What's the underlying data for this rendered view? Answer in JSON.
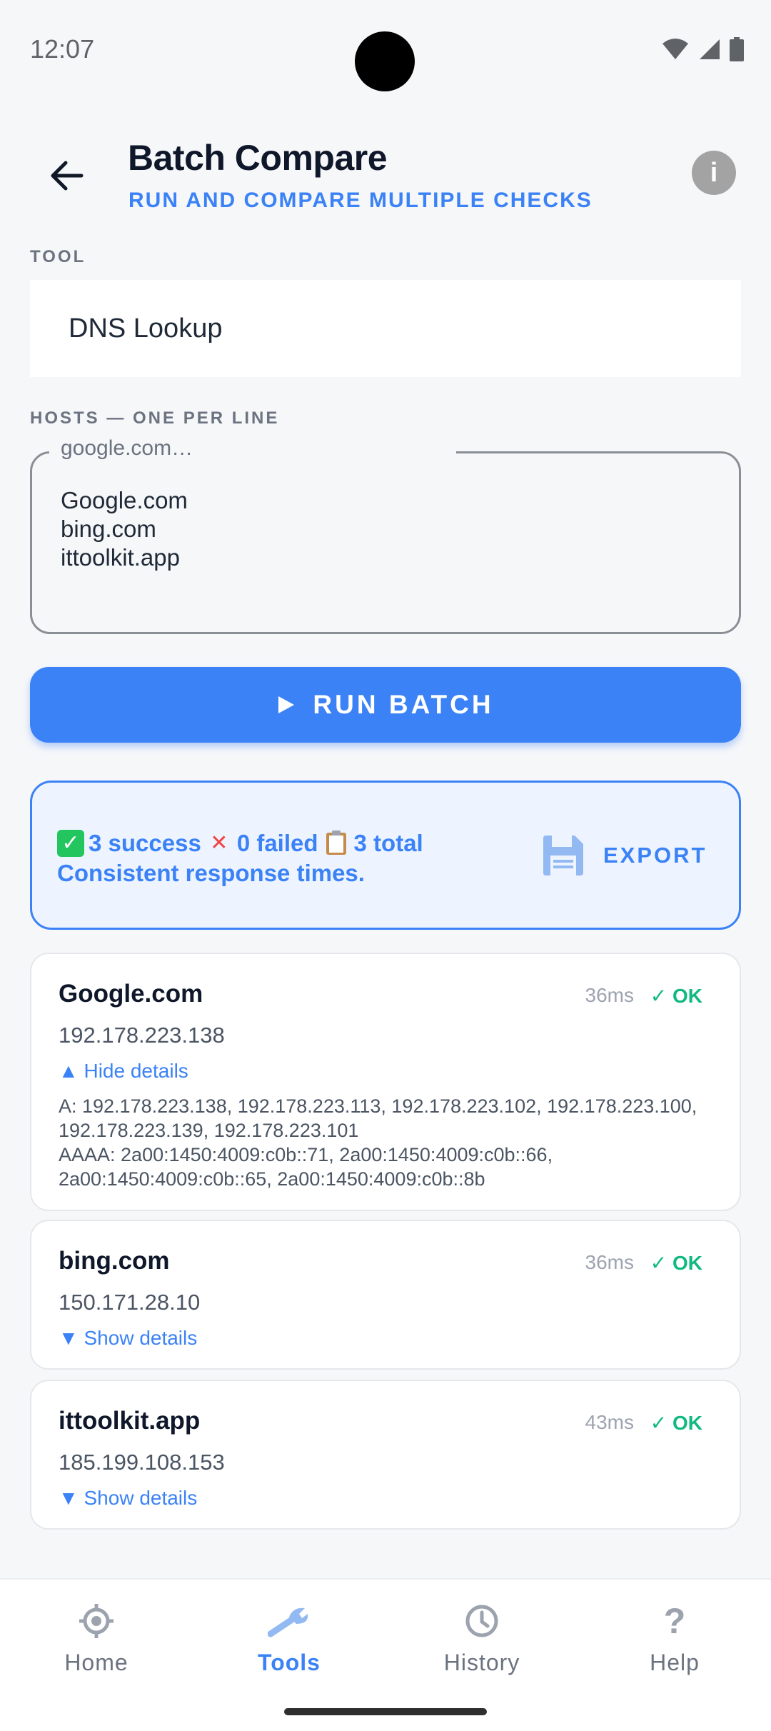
{
  "status_bar": {
    "time": "12:07"
  },
  "header": {
    "title": "Batch Compare",
    "subtitle": "RUN AND COMPARE MULTIPLE CHECKS",
    "back_icon": "arrow-left-icon",
    "info_icon": "info-icon"
  },
  "tool": {
    "label": "TOOL",
    "value": "DNS Lookup"
  },
  "hosts": {
    "label": "HOSTS — ONE PER LINE",
    "placeholder": "google.com…",
    "value": "Google.com\nbing.com\nittoolkit.app"
  },
  "run_button": {
    "label": "RUN BATCH",
    "icon": "play-icon"
  },
  "summary": {
    "success": "3 success",
    "failed": "0 failed",
    "total": "3 total",
    "note": "Consistent response times.",
    "export_label": "EXPORT",
    "export_icon": "save-icon"
  },
  "results": [
    {
      "host": "Google.com",
      "time": "36ms",
      "status": "✓ OK",
      "ip": "192.178.223.138",
      "toggle": "▲ Hide details",
      "details": "A: 192.178.223.138, 192.178.223.113, 192.178.223.102, 192.178.223.100, 192.178.223.139, 192.178.223.101\nAAAA: 2a00:1450:4009:c0b::71, 2a00:1450:4009:c0b::66, 2a00:1450:4009:c0b::65, 2a00:1450:4009:c0b::8b"
    },
    {
      "host": "bing.com",
      "time": "36ms",
      "status": "✓ OK",
      "ip": "150.171.28.10",
      "toggle": "▼ Show details"
    },
    {
      "host": "ittoolkit.app",
      "time": "43ms",
      "status": "✓ OK",
      "ip": "185.199.108.153",
      "toggle": "▼ Show details"
    }
  ],
  "bottom_nav": [
    {
      "label": "Home",
      "icon": "crosshair-icon",
      "active": false
    },
    {
      "label": "Tools",
      "icon": "wrench-icon",
      "active": true
    },
    {
      "label": "History",
      "icon": "clock-icon",
      "active": false
    },
    {
      "label": "Help",
      "icon": "question-icon",
      "active": false
    }
  ],
  "colors": {
    "accent": "#3b82f6",
    "ok": "#10b981",
    "background": "#f6f7f9"
  }
}
